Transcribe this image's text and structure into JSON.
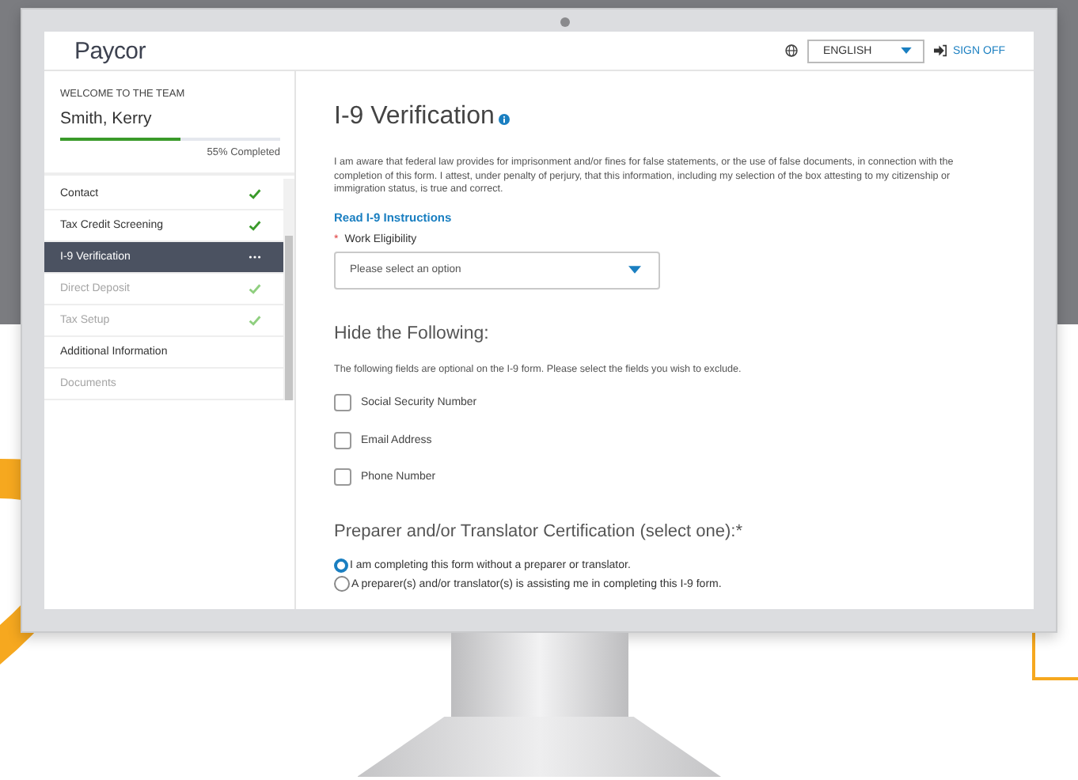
{
  "header": {
    "logo": "Paycor",
    "language": "ENGLISH",
    "sign_off": "SIGN OFF"
  },
  "sidebar": {
    "welcome": "WELCOME TO THE TEAM",
    "name": "Smith, Kerry",
    "progress": {
      "level": 0.55,
      "label": "55% Completed"
    },
    "items": [
      {
        "label": "Contact",
        "selected": false,
        "disabled": false,
        "done": true,
        "in_progress": false
      },
      {
        "label": "Tax Credit Screening",
        "selected": false,
        "disabled": false,
        "done": true,
        "in_progress": false
      },
      {
        "label": "I-9 Verification",
        "selected": true,
        "disabled": false,
        "done": false,
        "in_progress": true
      },
      {
        "label": "Direct Deposit",
        "selected": false,
        "disabled": true,
        "done": true,
        "in_progress": false
      },
      {
        "label": "Tax Setup",
        "selected": false,
        "disabled": true,
        "done": true,
        "in_progress": false
      },
      {
        "label": "Additional Information",
        "selected": false,
        "disabled": false,
        "done": false,
        "in_progress": false
      },
      {
        "label": "Documents",
        "selected": false,
        "disabled": true,
        "done": false,
        "in_progress": false
      }
    ]
  },
  "main": {
    "title": "I-9 Verification",
    "notice": "I am aware that federal law provides for imprisonment and/or fines for false statements, or the use of false documents, in connection with the completion of this form. I attest, under penalty of perjury, that this information, including my selection of the box attesting to my citizenship or immigration status, is true and correct.",
    "link": "Read I-9 Instructions",
    "work_eligibility": {
      "required_mark": "*",
      "label": "Work Eligibility",
      "placeholder": "Please select an option"
    },
    "hide_heading": "Hide the Following:",
    "hide_description": "The following fields are optional on the I-9 form. Please select the fields you wish to exclude.",
    "hide_options": [
      {
        "label": "Social Security Number",
        "checked": false
      },
      {
        "label": "Email Address",
        "checked": false
      },
      {
        "label": "Phone Number",
        "checked": false
      }
    ],
    "preparer_heading": "Preparer and/or Translator Certification (select one):*",
    "preparer_options": [
      {
        "label": "I am completing this form without a preparer or translator.",
        "selected": true
      },
      {
        "label": "A preparer(s) and/or translator(s) is assisting me in completing this I-9 form.",
        "selected": false
      }
    ]
  }
}
